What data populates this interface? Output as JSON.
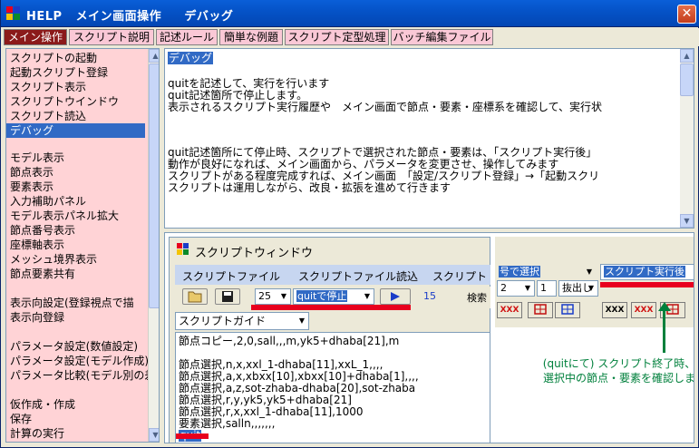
{
  "window": {
    "title_items": [
      "HELP",
      "メイン画面操作",
      "デバッグ"
    ],
    "close_glyph": "✕"
  },
  "tabs": [
    {
      "label": "メイン操作",
      "active": true
    },
    {
      "label": "スクリプト説明",
      "active": false
    },
    {
      "label": "記述ルール",
      "active": false
    },
    {
      "label": "簡単な例題",
      "active": false
    },
    {
      "label": "スクリプト定型処理",
      "active": false
    },
    {
      "label": "バッチ編集ファイル",
      "active": false
    }
  ],
  "sidebar": {
    "items": [
      "スクリプトの起動",
      "起動スクリプト登録",
      "スクリプト表示",
      "スクリプトウインドウ",
      "スクリプト読込",
      "デバッグ",
      "",
      "モデル表示",
      "節点表示",
      "要素表示",
      "入力補助パネル",
      "モデル表示パネル拡大",
      "節点番号表示",
      "座標軸表示",
      "メッシュ境界表示",
      "節点要素共有",
      "",
      "表示向設定(登録視点で描",
      "表示向登録",
      "",
      "パラメータ設定(数値設定)",
      "パラメータ設定(モデル作成)",
      "パラメータ比較(モデル別の差",
      "",
      "仮作成・作成",
      "保存",
      "計算の実行"
    ],
    "selected_index": 5
  },
  "main_text": {
    "heading": "デバッグ",
    "lines": [
      "",
      "quitを記述して、実行を行います",
      "quit記述箇所で停止します。",
      "表示されるスクリプト実行履歴や　メイン画面で節点・要素・座標系を確認して、実行状",
      "",
      "",
      "",
      "quit記述箇所にて停止時、スクリプトで選択された節点・要素は、「スクリプト実行後」",
      "動作が良好になれば、メイン画面から、パラメータを変更させ、操作してみます",
      "スクリプトがある程度完成すれば、メイン画面　「設定/スクリプト登録」→「起動スクリ",
      "スクリプトは運用しながら、改良・拡張を進めて行きます"
    ]
  },
  "script_window": {
    "title": "スクリプトウィンドウ",
    "menu": [
      "スクリプトファイル",
      "スクリプトファイル読込",
      "スクリプト"
    ],
    "line_number": "25",
    "stop_option": "quitで停止",
    "step_value": "15",
    "search_label": "検索",
    "guide_label": "スクリプトガイド",
    "editor_lines": [
      "節点コピー,2,0,sall,,,m,yk5+dhaba[21],m",
      "",
      "節点選択,n,x,xxl_1-dhaba[11],xxL_1,,,,",
      "節点選択,a,x,xbxx[10],xbxx[10]+dhaba[1],,,,",
      "節点選択,a,z,sot-zhaba-dhaba[20],sot-zhaba",
      "節点選択,r,y,yk5,yk5+dhaba[21]",
      "節点選択,r,x,xxl_1-dhaba[11],1000",
      "要素選択,salln,,,,,,,",
      "quit"
    ],
    "editor_highlight_index": 8
  },
  "right_panel": {
    "select_label": "号で選択",
    "run_after_label": "スクリプト実行後",
    "value_a": "2",
    "value_b": "1",
    "extract_label": "抜出し"
  },
  "annotation": {
    "line1": "(quitにて) スクリプト終了時、",
    "line2": "選択中の節点・要素を確認しま",
    "color": "#00803c"
  },
  "colors": {
    "selection": "#316ac5",
    "sidebar_bg": "#ffd3d6",
    "active_tab": "#8b1a1a",
    "marker_red": "#e8001e"
  }
}
